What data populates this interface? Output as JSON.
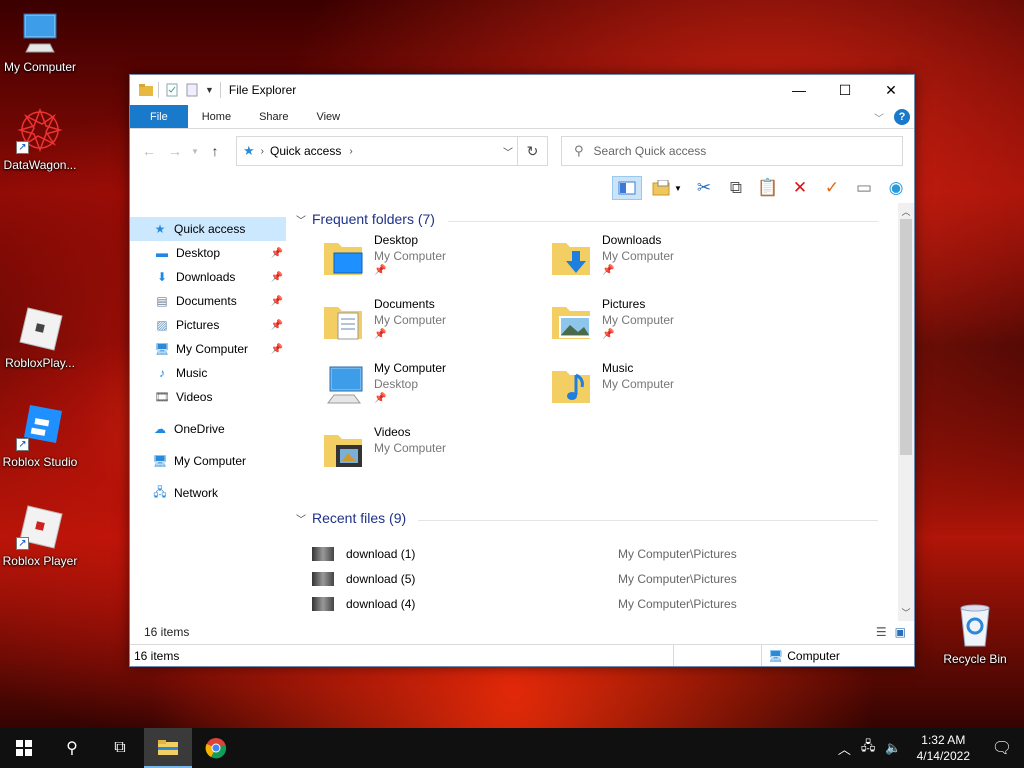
{
  "desktop": {
    "icons": [
      {
        "label": "My Computer",
        "icon": "computer-icon"
      },
      {
        "label": "DataWagon...",
        "icon": "datawagon-icon"
      },
      {
        "label": "RobloxPlay...",
        "icon": "roblox-icon"
      },
      {
        "label": "Roblox Studio",
        "icon": "roblox-studio-icon"
      },
      {
        "label": "Roblox Player",
        "icon": "roblox-icon"
      },
      {
        "label": "Recycle Bin",
        "icon": "recycle-bin-icon"
      }
    ]
  },
  "window": {
    "title": "File Explorer",
    "ribbon_tabs": [
      "File",
      "Home",
      "Share",
      "View"
    ],
    "address": {
      "crumb": "Quick access"
    },
    "search_placeholder": "Search Quick access",
    "nav": [
      {
        "label": "Quick access",
        "icon": "star-icon",
        "pinned": false,
        "selected": true
      },
      {
        "label": "Desktop",
        "icon": "desktop-icon",
        "pinned": true
      },
      {
        "label": "Downloads",
        "icon": "download-icon",
        "pinned": true
      },
      {
        "label": "Documents",
        "icon": "documents-icon",
        "pinned": true
      },
      {
        "label": "Pictures",
        "icon": "pictures-icon",
        "pinned": true
      },
      {
        "label": "My Computer",
        "icon": "computer-icon",
        "pinned": true
      },
      {
        "label": "Music",
        "icon": "music-icon",
        "pinned": false
      },
      {
        "label": "Videos",
        "icon": "videos-icon",
        "pinned": false
      },
      {
        "label": "OneDrive",
        "icon": "cloud-icon"
      },
      {
        "label": "My Computer",
        "icon": "computer-icon"
      },
      {
        "label": "Network",
        "icon": "network-icon"
      }
    ],
    "frequent": {
      "header": "Frequent folders (7)",
      "folders": [
        {
          "name": "Desktop",
          "location": "My Computer",
          "pinned": true
        },
        {
          "name": "Downloads",
          "location": "My Computer",
          "pinned": true
        },
        {
          "name": "Documents",
          "location": "My Computer",
          "pinned": true
        },
        {
          "name": "Pictures",
          "location": "My Computer",
          "pinned": true
        },
        {
          "name": "My Computer",
          "location": "Desktop",
          "pinned": true
        },
        {
          "name": "Music",
          "location": "My Computer",
          "pinned": false
        },
        {
          "name": "Videos",
          "location": "My Computer",
          "pinned": false
        }
      ]
    },
    "recent": {
      "header": "Recent files (9)",
      "files": [
        {
          "name": "download (1)",
          "path": "My Computer\\Pictures"
        },
        {
          "name": "download (5)",
          "path": "My Computer\\Pictures"
        },
        {
          "name": "download (4)",
          "path": "My Computer\\Pictures"
        }
      ]
    },
    "item_count": "16 items",
    "status": {
      "count": "16 items",
      "location": "Computer"
    }
  },
  "taskbar": {
    "clock_time": "1:32 AM",
    "clock_date": "4/14/2022"
  }
}
